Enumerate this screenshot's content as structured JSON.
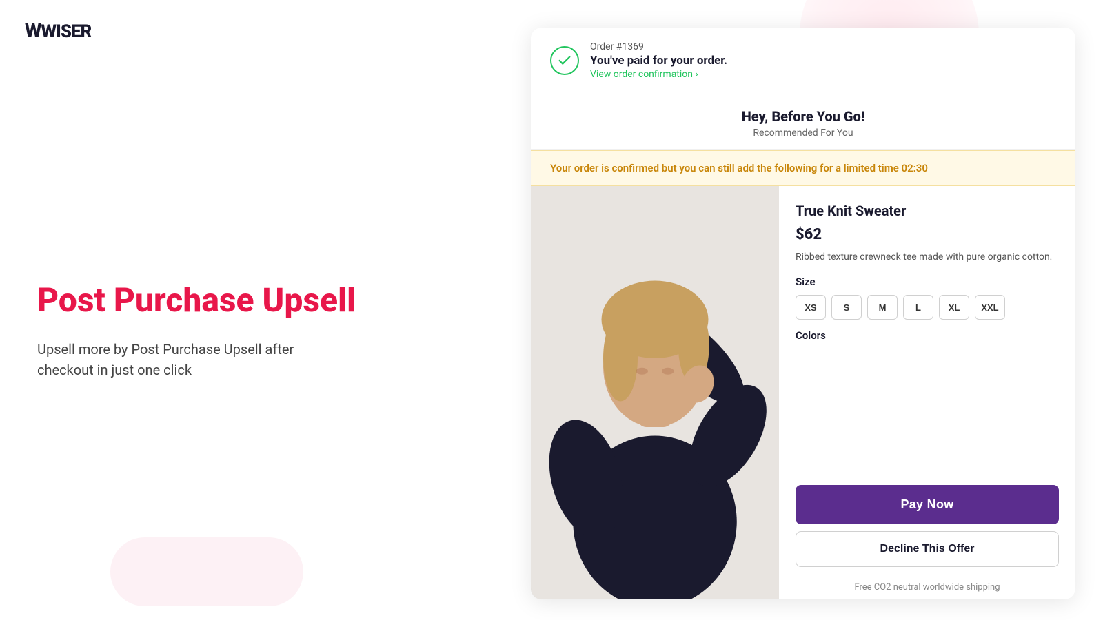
{
  "logo": {
    "text": "WISER"
  },
  "left": {
    "headline": "Post Purchase Upsell",
    "subtitle": "Upsell more by Post Purchase Upsell after checkout in just one click"
  },
  "order_bar": {
    "order_number": "Order #1369",
    "paid_text": "You've paid for your order.",
    "view_link": "View order confirmation ›"
  },
  "hey_section": {
    "title": "Hey, Before You Go!",
    "subtitle": "Recommended For You"
  },
  "timer_banner": {
    "text": "Your order is confirmed but you can still add the following for a limited time 02:30"
  },
  "product": {
    "name": "True Knit Sweater",
    "price": "$62",
    "description": "Ribbed texture crewneck tee made with pure organic cotton.",
    "size_label": "Size",
    "sizes": [
      "XS",
      "S",
      "M",
      "L",
      "XL",
      "XXL"
    ],
    "color_label": "Colors"
  },
  "actions": {
    "pay_now": "Pay Now",
    "decline": "Decline This Offer",
    "shipping_note": "Free CO2 neutral worldwide shipping"
  }
}
